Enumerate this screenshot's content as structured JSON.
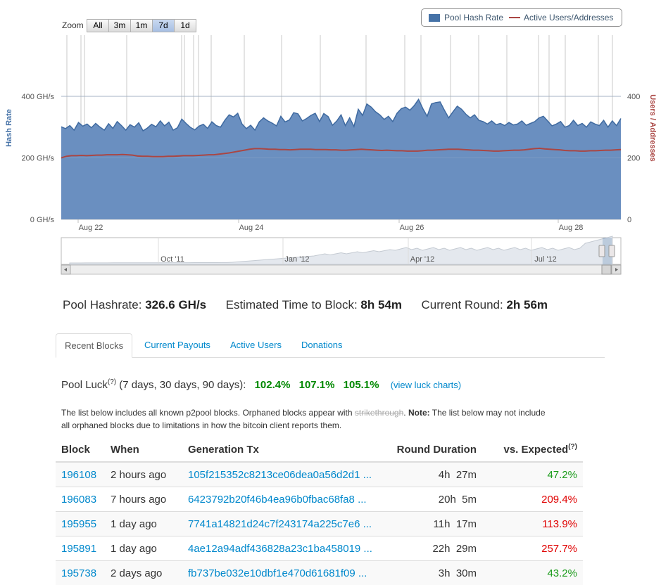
{
  "zoom": {
    "label": "Zoom",
    "buttons": [
      "All",
      "3m",
      "1m",
      "7d",
      "1d"
    ],
    "active": "7d"
  },
  "legend": {
    "hash": "Pool Hash Rate",
    "users": "Active Users/Addresses",
    "hash_color": "#4572a7",
    "users_color": "#aa4643"
  },
  "chart_data": {
    "type": "area",
    "title": "",
    "ylabel_left": "Hash Rate",
    "ylabel_right": "Users / Addresses",
    "y_ticks_left": [
      "0 GH/s",
      "200 GH/s",
      "400 GH/s"
    ],
    "y_ticks_right": [
      "0",
      "200",
      "400"
    ],
    "ylim": [
      0,
      400
    ],
    "x_ticks": [
      "Aug 22",
      "Aug 24",
      "Aug 26",
      "Aug 28"
    ],
    "navigator_ticks": [
      "Oct '11",
      "Jan '12",
      "Apr '12",
      "Jul '12"
    ],
    "series": [
      {
        "name": "Pool Hash Rate",
        "values": [
          301,
          295,
          305,
          290,
          315,
          303,
          310,
          298,
          312,
          300,
          290,
          311,
          296,
          318,
          305,
          290,
          308,
          300,
          314,
          288,
          297,
          309,
          301,
          320,
          304,
          316,
          290,
          298,
          326,
          312,
          299,
          291,
          303,
          309,
          296,
          317,
          305,
          300,
          322,
          340,
          333,
          345,
          310,
          295,
          306,
          290,
          317,
          330,
          320,
          313,
          304,
          335,
          317,
          323,
          347,
          343,
          320,
          328,
          338,
          345,
          318,
          344,
          334,
          306,
          320,
          340,
          305,
          330,
          302,
          358,
          338,
          375,
          365,
          350,
          340,
          325,
          335,
          318,
          345,
          360,
          365,
          355,
          370,
          390,
          360,
          335,
          375,
          380,
          382,
          355,
          330,
          350,
          368,
          358,
          342,
          330,
          340,
          322,
          318,
          310,
          320,
          308,
          312,
          305,
          315,
          307,
          310,
          320,
          306,
          312,
          318,
          330,
          335,
          320,
          304,
          310,
          318,
          300,
          305,
          322,
          305,
          312,
          300,
          317,
          310,
          305,
          322,
          300,
          320,
          305,
          328
        ]
      },
      {
        "name": "Active Users/Addresses",
        "values": [
          200,
          205,
          207,
          207,
          208,
          207,
          208,
          209,
          209,
          210,
          210,
          210,
          211,
          210,
          209,
          206,
          205,
          205,
          204,
          204,
          204,
          205,
          205,
          206,
          207,
          207,
          207,
          208,
          209,
          210,
          210,
          212,
          214,
          216,
          219,
          222,
          225,
          228,
          230,
          230,
          229,
          228,
          228,
          227,
          227,
          226,
          227,
          228,
          228,
          228,
          227,
          227,
          227,
          226,
          226,
          225,
          225,
          226,
          227,
          228,
          227,
          226,
          225,
          224,
          225,
          224,
          223,
          223,
          222,
          222,
          222,
          223,
          225,
          225,
          226,
          227,
          228,
          228,
          228,
          227,
          226,
          225,
          225,
          224,
          223,
          222,
          222,
          223,
          224,
          225,
          225,
          226,
          228,
          230,
          231,
          229,
          228,
          227,
          226,
          224,
          223,
          223,
          222,
          222,
          223,
          223,
          224,
          225,
          225,
          226,
          227
        ]
      }
    ]
  },
  "stats": {
    "hash_label": "Pool Hashrate:",
    "hash_value": "326.6 GH/s",
    "etb_label": "Estimated Time to Block:",
    "etb_value": "8h 54m",
    "round_label": "Current Round:",
    "round_value": "2h 56m"
  },
  "tabs": [
    "Recent Blocks",
    "Current Payouts",
    "Active Users",
    "Donations"
  ],
  "luck": {
    "label": "Pool Luck",
    "sup": "(?)",
    "periods": "(7 days, 30 days, 90 days):",
    "v7": "102.4%",
    "v30": "107.1%",
    "v90": "105.1%",
    "link": "(view luck charts)"
  },
  "note": {
    "a": "The list below includes all known p2pool blocks. Orphaned blocks appear with ",
    "strike": "strikethrough",
    "b": ". ",
    "bold": "Note:",
    "c": " The list below may not include all orphaned blocks due to limitations in how the bitcoin client reports them."
  },
  "table": {
    "headers": [
      "Block",
      "When",
      "Generation Tx",
      "Round Duration",
      "vs. Expected"
    ],
    "header_sup": "(?)",
    "rows": [
      {
        "block": "196108",
        "when": "2 hours ago",
        "tx": "105f215352c8213ce06dea0a56d2d1 ...",
        "h": "4h",
        "m": "27m",
        "exp": "47.2%",
        "good": true
      },
      {
        "block": "196083",
        "when": "7 hours ago",
        "tx": "6423792b20f46b4ea96b0fbac68fa8 ...",
        "h": "20h",
        "m": "5m",
        "exp": "209.4%",
        "good": false
      },
      {
        "block": "195955",
        "when": "1 day ago",
        "tx": "7741a14821d24c7f243174a225c7e6 ...",
        "h": "11h",
        "m": "17m",
        "exp": "113.9%",
        "good": false
      },
      {
        "block": "195891",
        "when": "1 day ago",
        "tx": "4ae12a94adf436828a23c1ba458019 ...",
        "h": "22h",
        "m": "29m",
        "exp": "257.7%",
        "good": false
      },
      {
        "block": "195738",
        "when": "2 days ago",
        "tx": "fb737be032e10dbf1e470d61681f09 ...",
        "h": "3h",
        "m": "30m",
        "exp": "43.2%",
        "good": true
      }
    ]
  }
}
